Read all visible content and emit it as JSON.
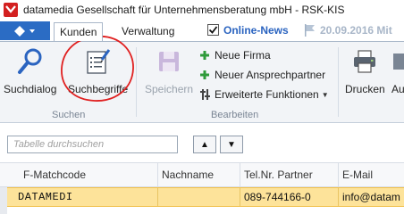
{
  "window": {
    "title": "datamedia Gesellschaft für Unternehmensberatung mbH - RSK-KIS",
    "app_icon": "red-app-logo-icon"
  },
  "ribbon_tabs": {
    "tabs": [
      {
        "label": "Kunden",
        "active": true
      },
      {
        "label": "Verwaltung",
        "active": false
      }
    ],
    "online_news": {
      "label": "Online-News",
      "checked": true
    },
    "news_date": "20.09.2016 Mit"
  },
  "ribbon": {
    "groups": {
      "suchen": {
        "label": "Suchen",
        "buttons": [
          {
            "label": "Suchdialog",
            "icon": "magnifier-icon"
          },
          {
            "label": "Suchbegriffe",
            "icon": "edit-list-icon"
          }
        ]
      },
      "bearbeiten": {
        "label": "Bearbeiten",
        "save": {
          "label": "Speichern",
          "icon": "floppy-disk-icon",
          "enabled": false
        },
        "small_buttons": [
          {
            "label": "Neue Firma",
            "icon": "green-plus-icon"
          },
          {
            "label": "Neuer Ansprechpartner",
            "icon": "green-plus-icon"
          },
          {
            "label": "Erweiterte Funktionen",
            "icon": "tools-icon",
            "dropdown": true
          }
        ]
      },
      "print": {
        "buttons": [
          {
            "label": "Drucken",
            "icon": "printer-icon"
          },
          {
            "label": "Au",
            "icon": "partial-icon"
          }
        ]
      }
    }
  },
  "search": {
    "placeholder": "Tabelle durchsuchen",
    "up_button": "▲",
    "down_button": "▼"
  },
  "grid": {
    "columns": [
      "F-Matchcode",
      "Nachname",
      "Tel.Nr. Partner",
      "E-Mail"
    ],
    "rows": [
      {
        "matchcode": "DATAMEDI",
        "nachname": "",
        "tel": "089-744166-0",
        "email": "info@datam"
      }
    ]
  },
  "colors": {
    "accent": "#2b6cc4",
    "selected_row": "#fde39a",
    "annotation_circle": "#e02020",
    "green_plus": "#2e9a3a"
  }
}
